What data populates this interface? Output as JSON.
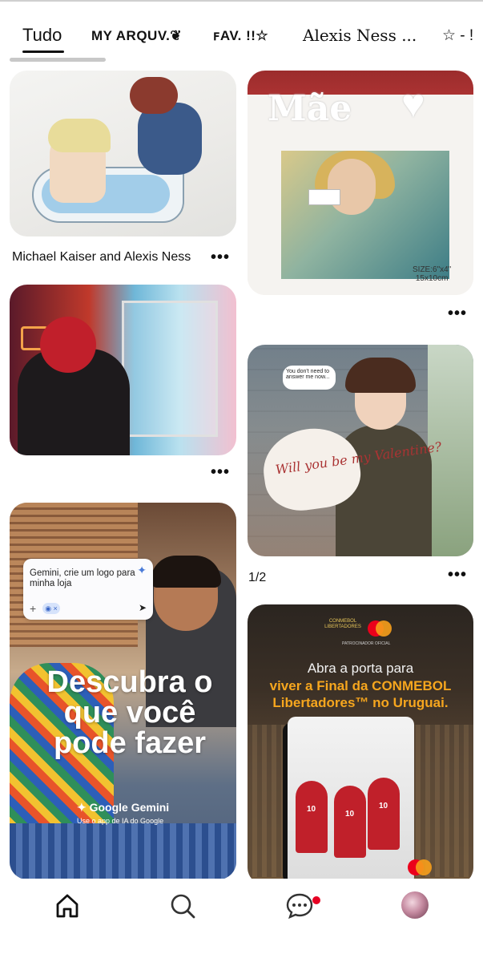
{
  "tabs": [
    {
      "label": "Tudo",
      "active": true
    },
    {
      "label": "MY ARQUV.❦"
    },
    {
      "label": "ꜰAV. !!☆"
    },
    {
      "label": "Alexis Ness ..."
    },
    {
      "label": "☆ - !"
    }
  ],
  "pins": [
    {
      "title": "Michael Kaiser and Alexis Ness",
      "more": "•••"
    },
    {
      "frame_word": "Mãe",
      "frame_heart": "♥",
      "size_label_1": "SIZE:6\"x4\"",
      "size_label_2": "15x10cm",
      "more": "•••"
    },
    {
      "more": "•••"
    },
    {
      "bubble_text": "You don't need to answer me now...",
      "heart_text": "Will you be my Valentine?",
      "subtitle": "1/2",
      "more": "•••"
    },
    {
      "prompt_text": "Gemini, crie um logo para minha loja",
      "prompt_spark": "✦",
      "prompt_plus": "+",
      "prompt_chip": "◉ ×",
      "prompt_send": "➤",
      "headline": "Descubra o que você pode fazer",
      "brand": "✦ Google Gemini",
      "brand_sub": "Use o app de IA do Google"
    },
    {
      "logo_text": "CONMEBOL LIBERTADORES",
      "sub_small": "PATROCINADOR OFICIAL",
      "line1": "Abra a porta para",
      "line2": "viver a Final da CONMEBOL",
      "line3": "Libertadores™ no Uruguai.",
      "jersey_number": "10"
    }
  ],
  "bottom_nav": {
    "items": [
      "home-icon",
      "search-icon",
      "messages-icon",
      "profile-avatar"
    ],
    "notification_color": "#e60023"
  },
  "colors": {
    "accent": "#e60023",
    "text": "#111111",
    "tab_indicator": "#111111"
  }
}
